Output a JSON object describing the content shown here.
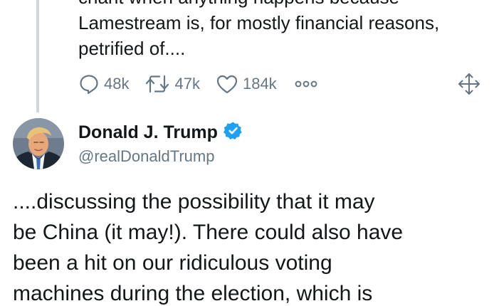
{
  "previous_tweet": {
    "text_lines": [
      "chant when anything happens because",
      "Lamestream is, for mostly financial reasons,",
      "petrified of...."
    ],
    "actions": {
      "replies": "48k",
      "retweets": "47k",
      "likes": "184k"
    }
  },
  "tweet": {
    "display_name": "Donald J. Trump",
    "handle": "@realDonaldTrump",
    "verified": true,
    "text_lines": [
      "....discussing the possibility that it may",
      "be China (it may!). There could also have",
      "been a hit on our ridiculous voting",
      "machines during the election, which is"
    ]
  },
  "colors": {
    "text": "#14171a",
    "secondary": "#657786",
    "thread_line": "#ccd6dd",
    "verified_blue": "#1da1f2"
  },
  "icons": {
    "reply": "reply-icon",
    "retweet": "retweet-icon",
    "like": "heart-icon",
    "more": "more-dots-icon",
    "expand": "expand-arrows-icon",
    "verified": "verified-badge-icon"
  }
}
